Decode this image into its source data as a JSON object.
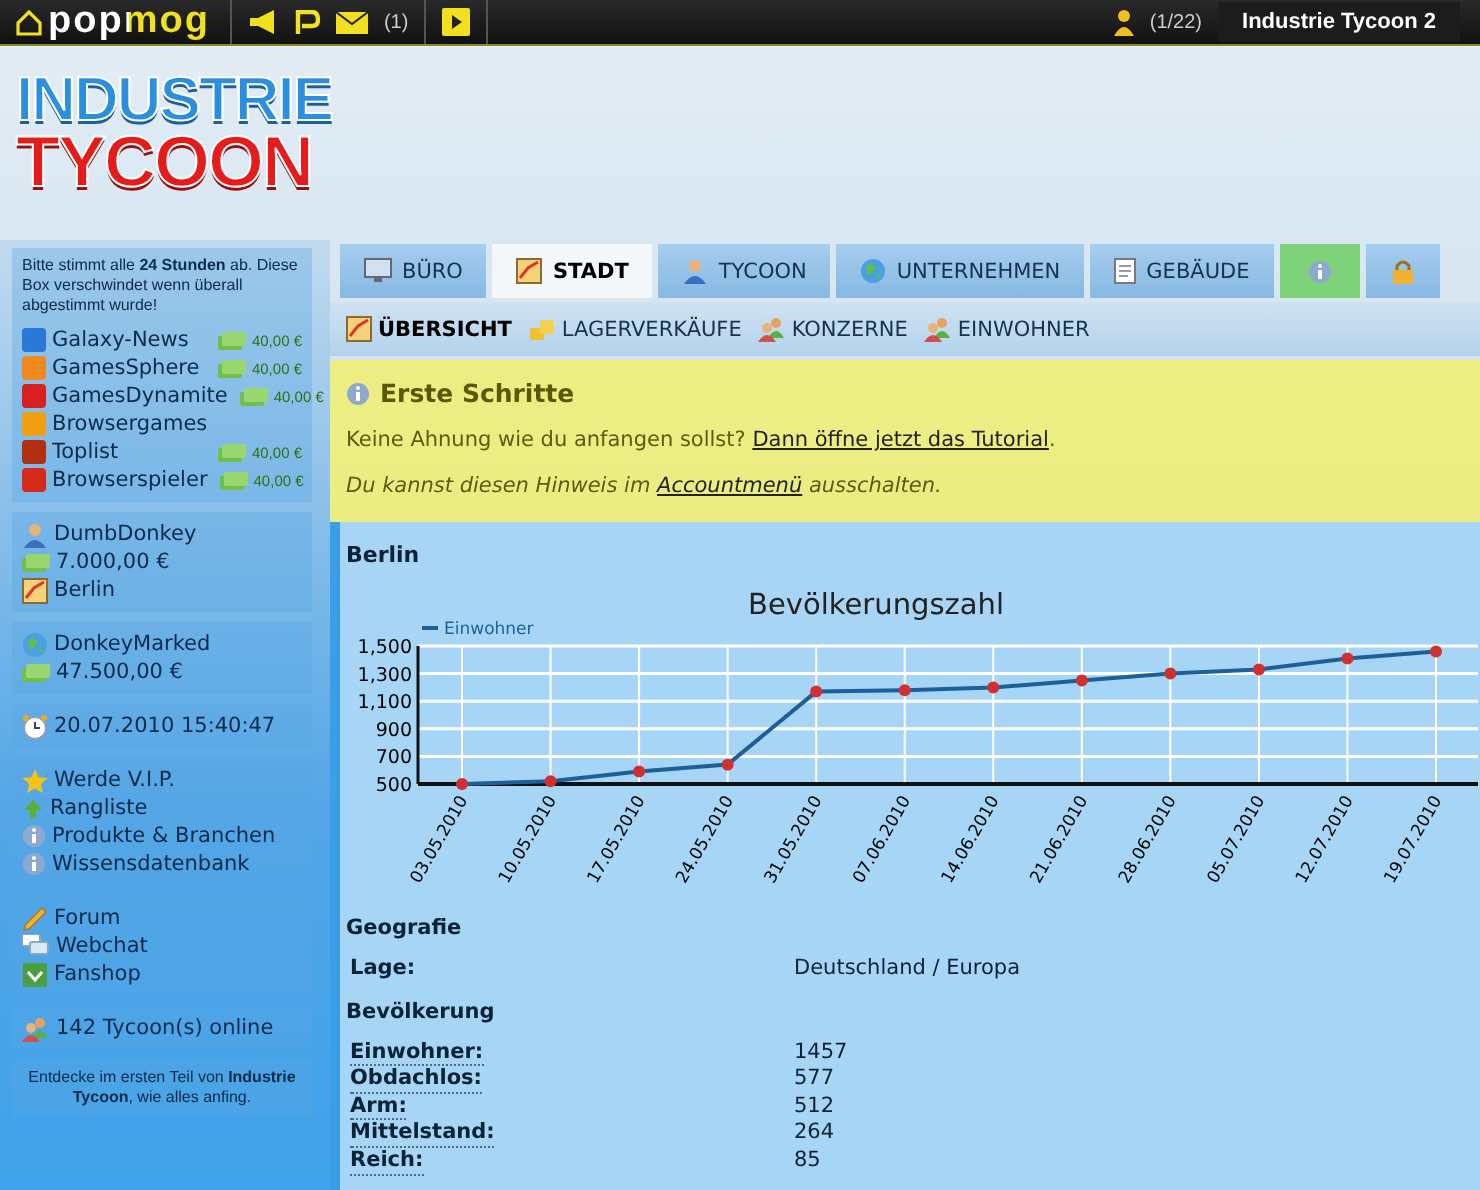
{
  "top_bar": {
    "logo": "popmog",
    "messages_count": "(1)",
    "players": "(1/22)",
    "game_tab": "Industrie Tycoon 2"
  },
  "header": {
    "logo_line_1": "INDUSTRIE",
    "logo_line_2": "TYCOON"
  },
  "sidebar": {
    "vote_note": "Bitte stimmt alle **24 Stunden** ab. Diese Box verschwindet wenn überall abgestimmt wurde!",
    "vote_sites": [
      {
        "name": "Galaxy-News",
        "reward": "40,00 €"
      },
      {
        "name": "GamesSphere",
        "reward": "40,00 €"
      },
      {
        "name": "GamesDynamite",
        "reward": "40,00 €"
      },
      {
        "name": "Browsergames"
      },
      {
        "name": "Toplist",
        "reward": "40,00 €"
      },
      {
        "name": "Browserspieler",
        "reward": "40,00 €"
      }
    ],
    "player": {
      "name": "DumbDonkey",
      "money": "7.000,00 €",
      "city": "Berlin"
    },
    "company": {
      "name": "DonkeyMarked",
      "money": "47.500,00 €"
    },
    "datetime": "20.07.2010 15:40:47",
    "links_1": [
      "Werde V.I.P.",
      "Rangliste",
      "Produkte & Branchen",
      "Wissensdatenbank"
    ],
    "links_2": [
      "Forum",
      "Webchat",
      "Fanshop"
    ],
    "online": "142 Tycoon(s) online",
    "promo": "Entdecke im ersten Teil von **Industrie Tycoon**, wie alles anfing."
  },
  "tabs": [
    {
      "kind": "text",
      "label": "BÜRO",
      "selected": false
    },
    {
      "kind": "text",
      "label": "STADT",
      "selected": true
    },
    {
      "kind": "text",
      "label": "TYCOON",
      "selected": false
    },
    {
      "kind": "text",
      "label": "UNTERNEHMEN",
      "selected": false
    },
    {
      "kind": "text",
      "label": "GEBÄUDE",
      "selected": false
    },
    {
      "kind": "help",
      "selected": false
    },
    {
      "kind": "lock",
      "selected": false
    }
  ],
  "subnav": [
    {
      "label": "ÜBERSICHT",
      "selected": true
    },
    {
      "label": "LAGERVERKÄUFE",
      "selected": false
    },
    {
      "label": "KONZERNE",
      "selected": false
    },
    {
      "label": "EINWOHNER",
      "selected": false
    }
  ],
  "notice": {
    "title": "Erste Schritte",
    "line_1": {
      "before": "Keine Ahnung wie du anfangen sollst? ",
      "link": "Dann öffne jetzt das Tutorial",
      "after": "."
    },
    "line_2": {
      "before": "Du kannst diesen Hinweis im ",
      "link": "Accountmenü",
      "after": " ausschalten."
    }
  },
  "city": {
    "title": "Berlin",
    "chart_data": {
      "type": "line",
      "title": "Bevölkerungszahl",
      "categories": [
        "03.05.2010",
        "10.05.2010",
        "17.05.2010",
        "24.05.2010",
        "31.05.2010",
        "07.06.2010",
        "14.06.2010",
        "21.06.2010",
        "28.06.2010",
        "05.07.2010",
        "12.07.2010",
        "19.07.2010"
      ],
      "series": [
        {
          "name": "Einwohner",
          "color": "#1f5f99",
          "marker": "circle",
          "values": [
            500,
            520,
            590,
            640,
            1170,
            1180,
            1200,
            1250,
            1300,
            1330,
            1410,
            1460
          ]
        }
      ],
      "ylim": [
        500,
        1500
      ],
      "grid": true,
      "yticks": [
        500,
        700,
        900,
        {
          "value": 1100,
          "label": "1,100"
        },
        {
          "value": 1300,
          "label": "1,300"
        },
        {
          "value": 1500,
          "label": "1,500"
        }
      ]
    },
    "sections": [
      {
        "title": "Geografie",
        "rows": [
          {
            "label": "Lage:",
            "value": "Deutschland / Europa",
            "underlined": false
          }
        ]
      },
      {
        "title": "Bevölkerung",
        "rows": [
          {
            "label": "Einwohner:",
            "value": "1457",
            "underlined": true
          },
          {
            "label": "Obdachlos:",
            "value": "577",
            "underlined": true
          },
          {
            "label": "Arm:",
            "value": "512",
            "underlined": true
          },
          {
            "label": "Mittelstand:",
            "value": "264",
            "underlined": true
          },
          {
            "label": "Reich:",
            "value": "85",
            "underlined": true
          }
        ]
      }
    ]
  }
}
